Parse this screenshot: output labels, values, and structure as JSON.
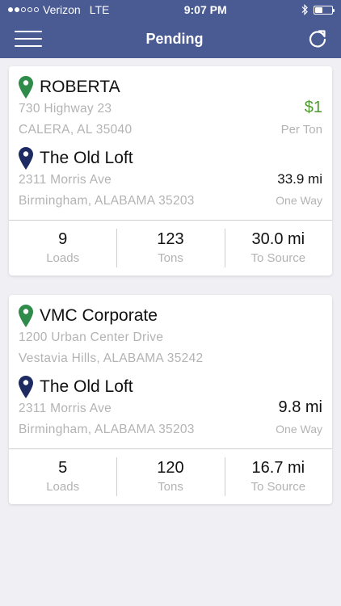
{
  "status_bar": {
    "carrier": "Verizon",
    "network": "LTE",
    "time": "9:07 PM",
    "signal_bars_filled": 2,
    "signal_bars_total": 5,
    "battery_level": 0.35
  },
  "navbar": {
    "title": "Pending",
    "menu_icon": "hamburger-menu-icon",
    "refresh_icon": "refresh-icon"
  },
  "colors": {
    "header": "#4a5b94",
    "source_pin": "#2e8b4a",
    "destination_pin": "#1e2b63",
    "rate": "#4d9a2e",
    "muted_text": "#b3b3b3"
  },
  "orders": [
    {
      "source": {
        "name": "ROBERTA",
        "address1": "730 Highway 23",
        "address2": "CALERA, AL 35040"
      },
      "rate": "$1",
      "rate_unit": "Per Ton",
      "destination": {
        "name": "The Old Loft",
        "address1": "2311 Morris Ave",
        "address2": "Birmingham, ALABAMA 35203"
      },
      "distance": "33.9 mi",
      "trip_type": "One Way",
      "stats": [
        {
          "value": "9",
          "label": "Loads"
        },
        {
          "value": "123",
          "label": "Tons"
        },
        {
          "value": "30.0 mi",
          "label": "To Source"
        }
      ]
    },
    {
      "source": {
        "name": "VMC Corporate",
        "address1": "1200 Urban Center Drive",
        "address2": "Vestavia Hills, ALABAMA 35242"
      },
      "rate": "",
      "rate_unit": "",
      "destination": {
        "name": "The Old Loft",
        "address1": "2311 Morris Ave",
        "address2": "Birmingham, ALABAMA 35203"
      },
      "distance": "9.8 mi",
      "trip_type": "One Way",
      "stats": [
        {
          "value": "5",
          "label": "Loads"
        },
        {
          "value": "120",
          "label": "Tons"
        },
        {
          "value": "16.7 mi",
          "label": "To Source"
        }
      ]
    }
  ]
}
